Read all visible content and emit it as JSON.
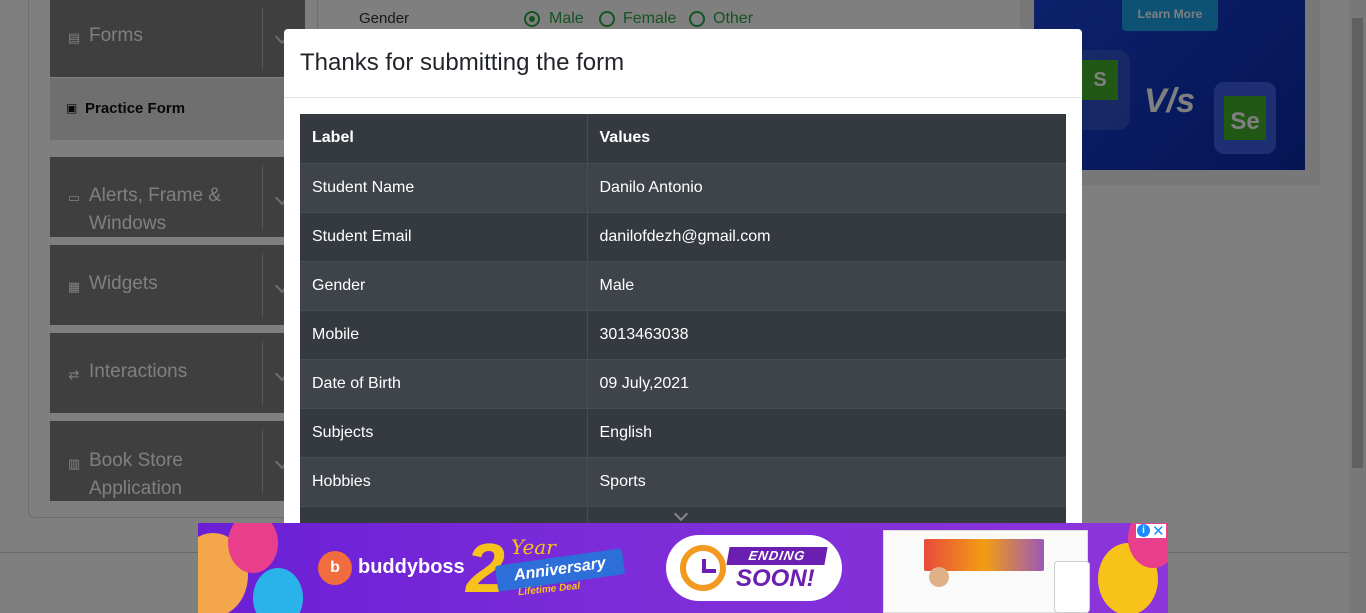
{
  "background": {
    "sidebar": {
      "groups": [
        {
          "label": "Forms",
          "icon": "document-icon"
        },
        {
          "label": "Alerts, Frame &",
          "label2": "Windows",
          "icon": "window-icon"
        },
        {
          "label": "Widgets",
          "icon": "widgets-icon"
        },
        {
          "label": "Interactions",
          "icon": "interactions-icon"
        },
        {
          "label": "Book Store",
          "label2": "Application",
          "icon": "books-icon"
        }
      ],
      "active_item": {
        "label": "Practice Form",
        "icon": "html5-icon"
      }
    },
    "form": {
      "gender_label": "Gender",
      "gender_options": [
        "Male",
        "Female",
        "Other"
      ],
      "selected_gender": "Male"
    },
    "right_ad": {
      "button": "Learn More",
      "vs": "V/s",
      "left_logo": "S",
      "right_logo": "Se"
    }
  },
  "modal": {
    "title": "Thanks for submitting the form",
    "table": {
      "headers": [
        "Label",
        "Values"
      ],
      "rows": [
        [
          "Student Name",
          "Danilo Antonio"
        ],
        [
          "Student Email",
          "danilofdezh@gmail.com"
        ],
        [
          "Gender",
          "Male"
        ],
        [
          "Mobile",
          "3013463038"
        ],
        [
          "Date of Birth",
          "09 July,2021"
        ],
        [
          "Subjects",
          "English"
        ],
        [
          "Hobbies",
          "Sports"
        ]
      ]
    }
  },
  "bottom_ad": {
    "brand": "buddyboss",
    "anniversary_number": "2",
    "anniversary_year": "Year",
    "anniversary_ribbon": "Anniversary",
    "anniversary_deal": "Lifetime Deal",
    "ending_line1": "ENDING",
    "ending_line2": "SOON!",
    "info_glyph": "i",
    "close_glyph": "✕"
  },
  "colors": {
    "accent_green": "#28a745",
    "table_dark": "#343a40",
    "table_stripe": "#3e444a",
    "ad_purple": "#6a1fd6"
  }
}
